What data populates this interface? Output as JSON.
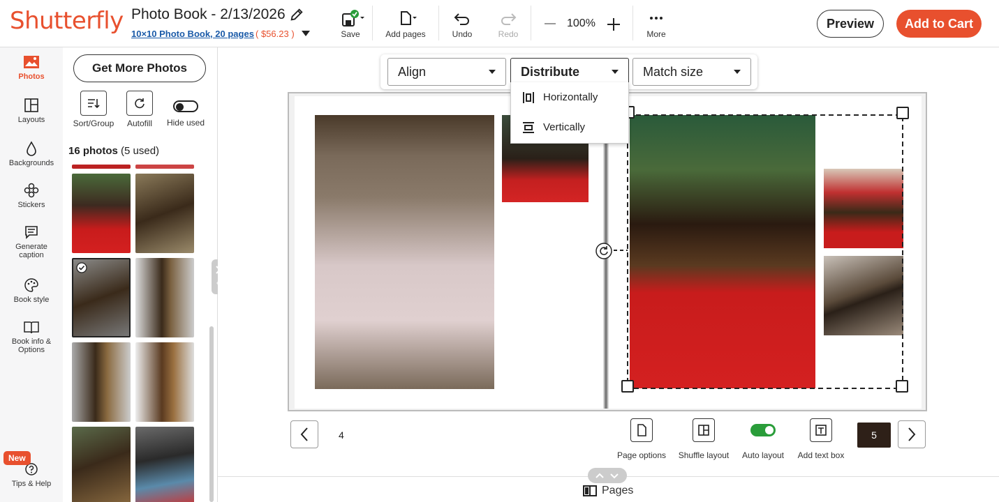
{
  "header": {
    "logo": "Shutterfly",
    "title": "Photo Book - 2/13/2026",
    "subtitle": "10×10 Photo Book, 20 pages",
    "price": "( $56.23 )",
    "toolbar": {
      "save": "Save",
      "add_pages": "Add pages",
      "undo": "Undo",
      "redo": "Redo",
      "zoom": "100%",
      "more": "More"
    },
    "preview": "Preview",
    "add_to_cart": "Add to Cart"
  },
  "leftnav": {
    "items": [
      {
        "label": "Photos",
        "icon": "photos-icon"
      },
      {
        "label": "Layouts",
        "icon": "layouts-icon"
      },
      {
        "label": "Backgrounds",
        "icon": "backgrounds-icon"
      },
      {
        "label": "Stickers",
        "icon": "stickers-icon"
      },
      {
        "label": "Generate caption",
        "icon": "caption-icon"
      },
      {
        "label": "Book style",
        "icon": "palette-icon"
      },
      {
        "label": "Book info & Options",
        "icon": "book-icon"
      }
    ],
    "new_badge": "New",
    "tips": "Tips & Help"
  },
  "panel": {
    "get_more": "Get More Photos",
    "sort_group": "Sort/Group",
    "autofill": "Autofill",
    "hide_used": "Hide used",
    "photo_count": "16 photos",
    "used_count": "(5 used)"
  },
  "arrange": {
    "align": "Align",
    "distribute": "Distribute",
    "match_size": "Match size",
    "distribute_options": [
      "Horizontally",
      "Vertically"
    ]
  },
  "pages": {
    "left_number": "4",
    "right_number": "5",
    "page_options": "Page options",
    "shuffle_layout": "Shuffle layout",
    "auto_layout": "Auto layout",
    "add_text_box": "Add text box",
    "pages_label": "Pages"
  },
  "colors": {
    "brand": "#e8502e",
    "link": "#1a5aa8",
    "toggle_on": "#2a9d3a"
  }
}
